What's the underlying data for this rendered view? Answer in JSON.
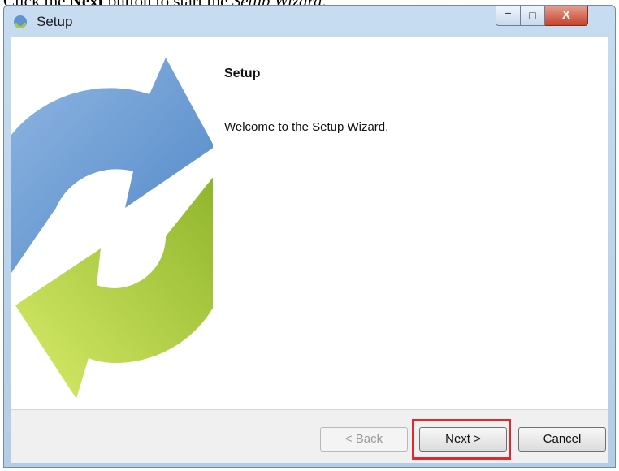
{
  "caption": {
    "pre": "Click the ",
    "bold": "Next",
    "mid": " button to start the ",
    "italic": "Setup Wizard",
    "post": "."
  },
  "window": {
    "title": "Setup",
    "icon": "setup-app-icon",
    "controls": {
      "minimize": "−",
      "maximize": "□",
      "close": "X"
    }
  },
  "content": {
    "heading": "Setup",
    "welcome": "Welcome to the Setup Wizard."
  },
  "buttons": {
    "back": "< Back",
    "next": "Next >",
    "cancel": "Cancel"
  },
  "colors": {
    "highlight": "#e0282f",
    "arrow_blue": "#5f94d0",
    "arrow_green": "#a9c93c"
  }
}
